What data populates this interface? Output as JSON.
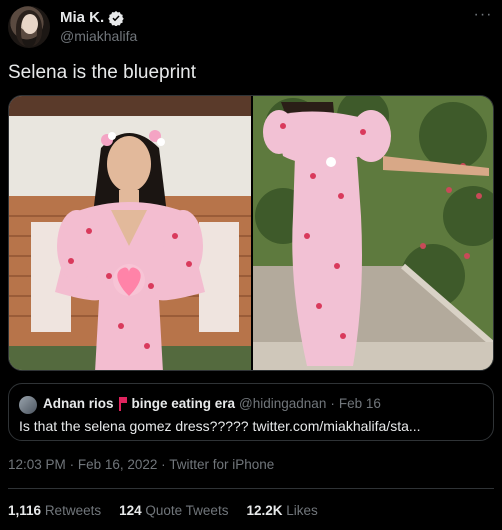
{
  "author": {
    "display_name": "Mia K.",
    "handle": "@miakhalifa",
    "verified_icon": "verified-badge-icon",
    "verified_color": "#e7e9ea"
  },
  "tweet": {
    "text": "Selena is the blueprint",
    "images": [
      {
        "alt": "woman in pink floral dress with glowing heart"
      },
      {
        "alt": "woman in pink floral dress outdoors"
      }
    ]
  },
  "quote": {
    "name": "Adnan rios",
    "name_suffix": "binge eating era",
    "handle": "@hidingadnan",
    "separator": "·",
    "date": "Feb 16",
    "text": "Is that the selena gomez dress????? twitter.com/miakhalifa/sta...",
    "flag_color": "#e0245e"
  },
  "meta": {
    "time": "12:03 PM",
    "sep1": "·",
    "date": "Feb 16, 2022",
    "sep2": "·",
    "source": "Twitter for iPhone"
  },
  "stats": {
    "retweets_count": "1,116",
    "retweets_label": "Retweets",
    "quotes_count": "124",
    "quotes_label": "Quote Tweets",
    "likes_count": "12.2K",
    "likes_label": "Likes"
  },
  "colors": {
    "background": "#000000",
    "text": "#e7e9ea",
    "secondary": "#71767b",
    "border": "#2f3336"
  }
}
